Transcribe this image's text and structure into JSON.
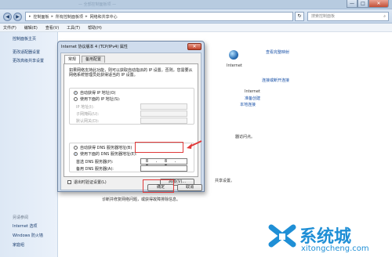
{
  "window": {
    "title_faint": "— 全部控制面板项 —",
    "controls": {
      "minimize": "—",
      "maximize": "□",
      "close": "✕"
    }
  },
  "address": {
    "back": "◀",
    "forward": "▶",
    "crumbs": [
      "控制面板",
      "所有控制面板项",
      "网络和共享中心"
    ],
    "refresh": "↻",
    "search_placeholder": "搜索控制面板"
  },
  "menu": [
    "文件(F)",
    "编辑(E)",
    "查看(V)",
    "工具(T)",
    "帮助(H)"
  ],
  "sidebar": {
    "links": [
      "控制面板主页",
      "更改适配器设置",
      "更改高级共享设置"
    ],
    "see_also_header": "另请参阅",
    "see_also": [
      "Internet 选项",
      "Windows 防火墙",
      "家庭组"
    ]
  },
  "main": {
    "view_full_map": "查看完整映射",
    "internet_label": "Internet",
    "connect_disconnect": "连接或断开连接",
    "access_type_value": "Internet",
    "homegroup_value": "准备创建",
    "connection_value": "本地连接",
    "partial_text_1": "器访问点。",
    "partial_text_2": "共享设置。",
    "bottom_text": "诊断并修复网络问题，或获得故障排除信息。"
  },
  "dialog": {
    "title": "Internet 协议版本 4 (TCP/IPv4) 属性",
    "close": "✕",
    "tabs": [
      "常规",
      "备用配置"
    ],
    "description": "如果网络支持此功能，则可以获取自动指派的 IP 设置。否则，您需要从网络系统管理员处获得适当的 IP 设置。",
    "ip": {
      "auto_label": "自动获得 IP 地址(O)",
      "manual_label": "使用下面的 IP 地址(S):",
      "fields": [
        "IP 地址(I):",
        "子网掩码(U):",
        "默认网关(D):"
      ]
    },
    "dns": {
      "auto_label": "自动获得 DNS 服务器地址(B)",
      "manual_label": "使用下面的 DNS 服务器地址(E):",
      "preferred_label": "首选 DNS 服务器(P):",
      "preferred_value": "8 . 8 . 8 . 8",
      "alternate_label": "备用 DNS 服务器(A):"
    },
    "validate_label": "退出时验证设置(L)",
    "advanced_button": "高级(V)...",
    "ok_button": "确定",
    "cancel_button": "取消"
  },
  "watermark": {
    "brand": "系统城",
    "url": "xitongcheng.com"
  },
  "colors": {
    "highlight": "#e03a3a",
    "link": "#1a52a8",
    "titlebar": "#b7cbe0"
  }
}
